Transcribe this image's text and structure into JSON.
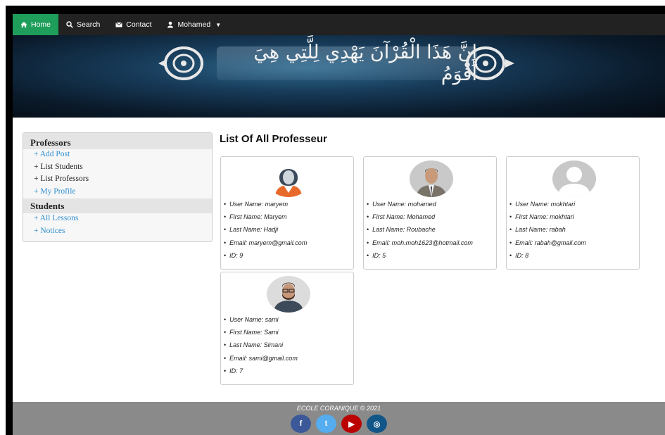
{
  "navbar": {
    "home": "Home",
    "search": "Search",
    "contact": "Contact",
    "user": "Mohamed"
  },
  "banner": {
    "text": "إِنَّ هَذَا الْقُرْآنَ يَهْدِي لِلَّتِي هِيَ أَقْوَمُ"
  },
  "sidebar": {
    "professors_heading": "Professors",
    "professors_items": [
      "+ Add Post",
      "+ List Students",
      "+ List Professors",
      "+ My Profile"
    ],
    "students_heading": "Students",
    "students_items": [
      "+ All Lessons",
      "+ Notices"
    ]
  },
  "main": {
    "title": "List Of All Professeur"
  },
  "professors": [
    {
      "user_name": "User Name: maryem",
      "first_name": "First Name: Maryem",
      "last_name": "Last Name: Hadji",
      "email": "Email: maryem@gmail.com",
      "id": "ID: 9"
    },
    {
      "user_name": "User Name: mohamed",
      "first_name": "First Name: Mohamed",
      "last_name": "Last Name: Roubache",
      "email": "Email: moh.moh1623@hotmail.com",
      "id": "ID: 5"
    },
    {
      "user_name": "User Name: mokhtari",
      "first_name": "First Name: mokhtari",
      "last_name": "Last Name: rabah",
      "email": "Email: rabah@gmail.com",
      "id": "ID: 8"
    },
    {
      "user_name": "User Name: sami",
      "first_name": "First Name: Sami",
      "last_name": "Last Name: Simani",
      "email": "Email: sami@gmail.com",
      "id": "ID: 7"
    }
  ],
  "footer": {
    "text": "ECOLE CORANIQUE © 2021",
    "socials": [
      {
        "icon": "facebook-icon",
        "glyph": "f",
        "color": "#3b5998"
      },
      {
        "icon": "twitter-icon",
        "glyph": "t",
        "color": "#55acee"
      },
      {
        "icon": "youtube-icon",
        "glyph": "▶",
        "color": "#bb0000"
      },
      {
        "icon": "instagram-icon",
        "glyph": "◎",
        "color": "#125688"
      }
    ]
  },
  "colors": {
    "nav_active": "#1e9e5a",
    "navbar_bg": "#222222",
    "link": "#2f8fd0",
    "footer_bg": "#8a8a8a"
  }
}
